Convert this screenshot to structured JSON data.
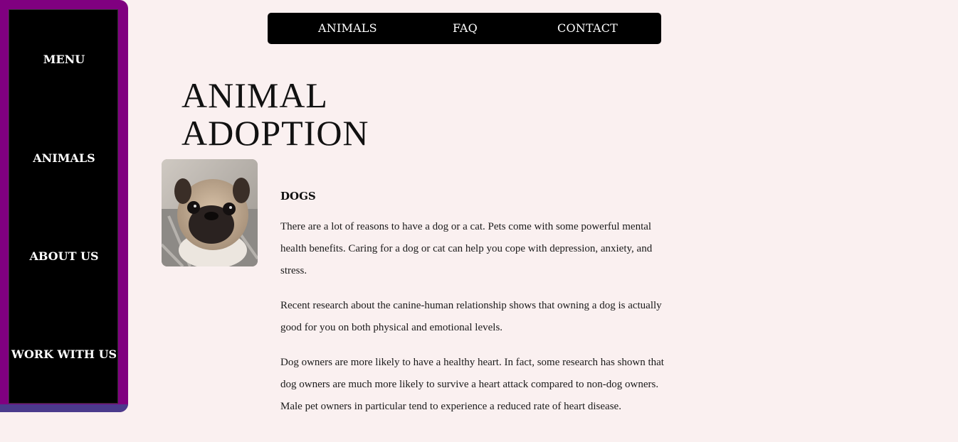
{
  "sidebar": {
    "items": [
      {
        "label": "MENU"
      },
      {
        "label": "ANIMALS"
      },
      {
        "label": "ABOUT US"
      },
      {
        "label": "WORK WITH US"
      }
    ]
  },
  "topnav": {
    "items": [
      {
        "label": "ANIMALS"
      },
      {
        "label": "FAQ"
      },
      {
        "label": "CONTACT"
      }
    ]
  },
  "main": {
    "title_line1": "ANIMAL",
    "title_line2": "ADOPTION",
    "section_heading": "DOGS",
    "paragraphs": [
      "There are a lot of reasons to have a dog or a cat. Pets come with some powerful mental health benefits. Caring for a dog or cat can help you cope with depression, anxiety, and stress.",
      "Recent research about the canine-human relationship shows that owning a dog is actually good for you on both physical and emotional levels.",
      "Dog owners are more likely to have a healthy heart. In fact, some research has shown that dog owners are much more likely to survive a heart attack compared to non-dog owners. Male pet owners in particular tend to experience a reduced rate of heart disease."
    ]
  },
  "colors": {
    "page_background": "#faf0f0",
    "sidebar_frame": "#800080",
    "sidebar_frame_bottom": "#4b3a8c",
    "nav_background": "#000000",
    "nav_text": "#ffffff"
  }
}
